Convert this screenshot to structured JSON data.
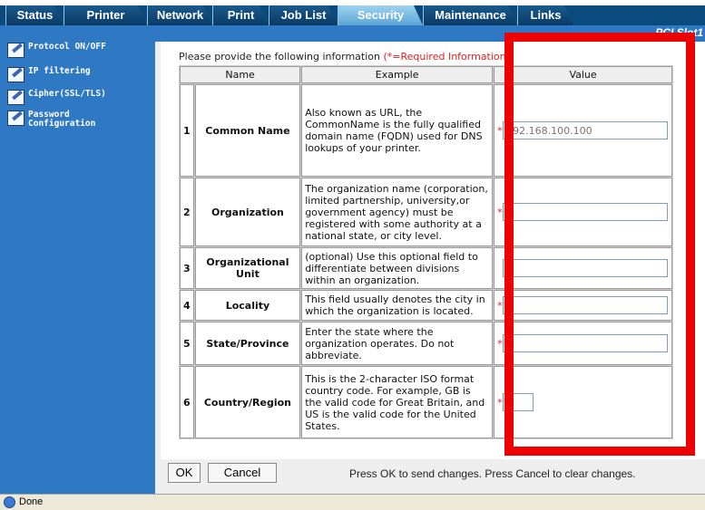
{
  "tabs": [
    {
      "label": "Status"
    },
    {
      "label": "Printer"
    },
    {
      "label": "Network"
    },
    {
      "label": "Print"
    },
    {
      "label": "Job List"
    },
    {
      "label": "Security",
      "active": true
    },
    {
      "label": "Maintenance"
    },
    {
      "label": "Links"
    }
  ],
  "header": {
    "pci_label": "PCI Slot1"
  },
  "sidebar": {
    "items": [
      {
        "label": "Protocol ON/OFF"
      },
      {
        "label": "IP filtering"
      },
      {
        "label": "Cipher(SSL/TLS)"
      },
      {
        "label": "Password Configuration"
      }
    ]
  },
  "form": {
    "instruction": "Please provide the following information ",
    "required_note": "(*=Required Information)",
    "columns": {
      "name": "Name",
      "example": "Example",
      "value": "Value"
    },
    "rows": [
      {
        "num": "1",
        "name": "Common Name",
        "example": "Also known as URL, the CommonName is the fully qualified domain name (FQDN) used for DNS lookups of your printer.",
        "required": "*",
        "placeholder": "192.168.100.100",
        "value": ""
      },
      {
        "num": "2",
        "name": "Organization",
        "example": "The organization name (corporation, limited partnership, university,or government agency) must be registered with some authority at a national state, or city level.",
        "required": "*",
        "placeholder": "",
        "value": ""
      },
      {
        "num": "3",
        "name": "Organizational Unit",
        "example": "(optional) Use this optional field to differentiate between divisions within an organization.",
        "required": "",
        "placeholder": "",
        "value": ""
      },
      {
        "num": "4",
        "name": "Locality",
        "example": "This field usually denotes the city in which the organization is located.",
        "required": "*",
        "placeholder": "",
        "value": ""
      },
      {
        "num": "5",
        "name": "State/Province",
        "example": "Enter the state where the organization operates. Do not abbreviate.",
        "required": "*",
        "placeholder": "",
        "value": ""
      },
      {
        "num": "6",
        "name": "Country/Region",
        "example": "This is the 2-character ISO format country code. For example, GB is the valid code for Great Britain, and US is the valid code for the United States.",
        "required": "*",
        "placeholder": "",
        "value": ""
      }
    ]
  },
  "buttons": {
    "ok": "OK",
    "cancel": "Cancel"
  },
  "bottom_text": "Press OK to send changes. Press Cancel to clear changes.",
  "status_bar": {
    "text": "Done"
  },
  "colors": {
    "accent_red": "#ee0000",
    "sidebar_blue": "#2f78c4",
    "tab_dark": "#0a3a66"
  }
}
